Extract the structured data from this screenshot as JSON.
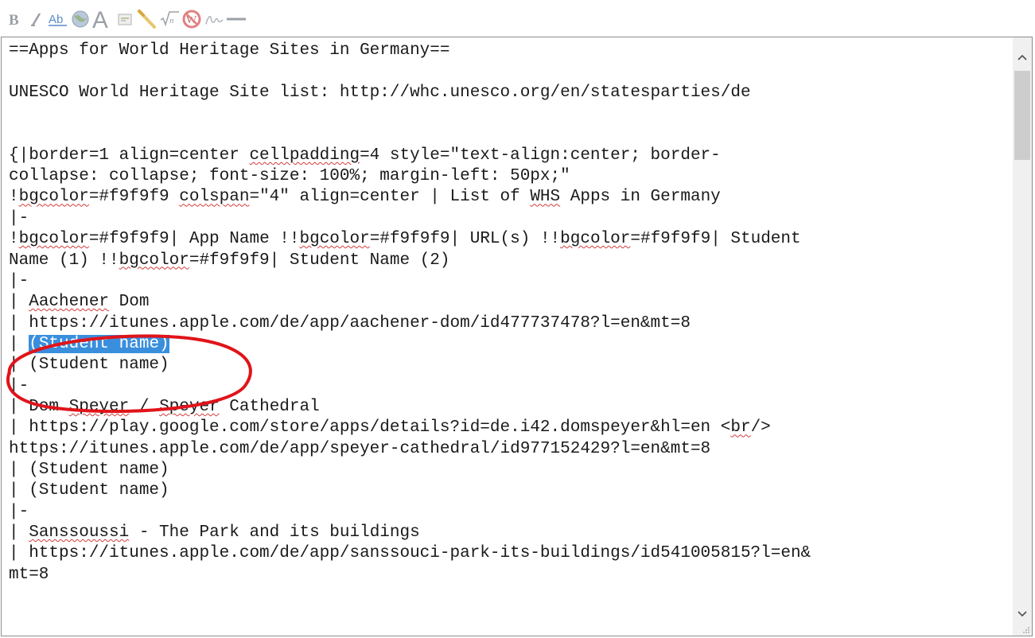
{
  "toolbar": {
    "buttons": [
      {
        "name": "bold-button",
        "icon": "bold-icon",
        "glyph": "B"
      },
      {
        "name": "italic-button",
        "icon": "italic-icon",
        "glyph": "I"
      },
      {
        "name": "internal-link-button",
        "icon": "link-icon",
        "glyph": "Ab"
      },
      {
        "name": "external-link-button",
        "icon": "globe-icon"
      },
      {
        "name": "headline-button",
        "icon": "headline-icon",
        "glyph": "A"
      },
      {
        "name": "embedded-file-button",
        "icon": "image-icon"
      },
      {
        "name": "file-link-button",
        "icon": "media-icon"
      },
      {
        "name": "math-formula-button",
        "icon": "formula-icon",
        "glyph": "√n"
      },
      {
        "name": "nowiki-button",
        "icon": "nowiki-icon",
        "glyph": "W"
      },
      {
        "name": "signature-button",
        "icon": "signature-icon"
      },
      {
        "name": "horizontal-line-button",
        "icon": "horizontal-line-icon"
      }
    ]
  },
  "editor": {
    "lines": [
      [
        {
          "t": "==Apps for World Heritage Sites in Germany=="
        }
      ],
      [],
      [
        {
          "t": "UNESCO World Heritage Site list: http://whc.unesco.org/en/statesparties/de"
        }
      ],
      [],
      [],
      [
        {
          "t": "{|border=1 align=center "
        },
        {
          "t": "cellpadding",
          "spell": true
        },
        {
          "t": "=4 style=\"text-align:center; border-"
        }
      ],
      [
        {
          "t": "collapse: collapse; font-size: 100%; margin-left: 50px;\""
        }
      ],
      [
        {
          "t": "!"
        },
        {
          "t": "bgcolor",
          "spell": true
        },
        {
          "t": "=#f9f9f9 "
        },
        {
          "t": "colspan",
          "spell": true
        },
        {
          "t": "=\"4\" align=center | List of "
        },
        {
          "t": "WHS",
          "spell": true
        },
        {
          "t": " Apps in Germany"
        }
      ],
      [
        {
          "t": "|-"
        }
      ],
      [
        {
          "t": "!"
        },
        {
          "t": "bgcolor",
          "spell": true
        },
        {
          "t": "=#f9f9f9| App Name !!"
        },
        {
          "t": "bgcolor",
          "spell": true
        },
        {
          "t": "=#f9f9f9| URL(s) !!"
        },
        {
          "t": "bgcolor",
          "spell": true
        },
        {
          "t": "=#f9f9f9| Student"
        }
      ],
      [
        {
          "t": "Name (1) !!"
        },
        {
          "t": "bgcolor",
          "spell": true
        },
        {
          "t": "=#f9f9f9| Student Name (2)"
        }
      ],
      [
        {
          "t": "|-"
        }
      ],
      [
        {
          "t": "| "
        },
        {
          "t": "Aachener",
          "spell": true
        },
        {
          "t": " Dom"
        }
      ],
      [
        {
          "t": "| https://itunes.apple.com/de/app/aachener-dom/id477737478?l=en&mt=8"
        }
      ],
      [
        {
          "t": "| "
        },
        {
          "t": "(Student name)",
          "selected": true
        }
      ],
      [
        {
          "t": "| (Student name)"
        }
      ],
      [
        {
          "t": "|-"
        }
      ],
      [
        {
          "t": "| Dom "
        },
        {
          "t": "Speyer",
          "spell": true
        },
        {
          "t": " / "
        },
        {
          "t": "Speyer",
          "spell": true
        },
        {
          "t": " Cathedral"
        }
      ],
      [
        {
          "t": "| https://play.google.com/store/apps/details?id=de.i42.domspeyer&hl=en <"
        },
        {
          "t": "br",
          "spell": true
        },
        {
          "t": "/>"
        }
      ],
      [
        {
          "t": "https://itunes.apple.com/de/app/speyer-cathedral/id977152429?l=en&mt=8"
        }
      ],
      [
        {
          "t": "| (Student name)"
        }
      ],
      [
        {
          "t": "| (Student name)"
        }
      ],
      [
        {
          "t": "|-"
        }
      ],
      [
        {
          "t": "| "
        },
        {
          "t": "Sanssoussi",
          "spell": true
        },
        {
          "t": " - The Park and its buildings"
        }
      ],
      [
        {
          "t": "| https://itunes.apple.com/de/app/sanssouci-park-its-buildings/id541005815?l=en&"
        }
      ],
      [
        {
          "t": "mt=8"
        }
      ]
    ]
  },
  "colors": {
    "selection": "#3a8fdd",
    "annotation_circle": "#e0141a",
    "spellcheck": "#d43b3b"
  }
}
